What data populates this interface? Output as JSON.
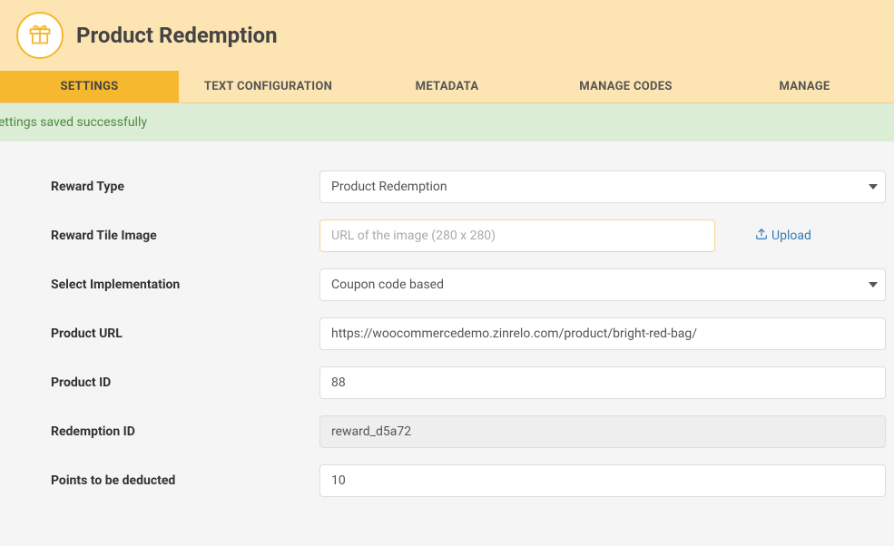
{
  "header": {
    "title": "Product Redemption",
    "icon": "gift-icon"
  },
  "tabs": [
    {
      "label": "SETTINGS",
      "active": true
    },
    {
      "label": "TEXT CONFIGURATION",
      "active": false
    },
    {
      "label": "METADATA",
      "active": false
    },
    {
      "label": "MANAGE CODES",
      "active": false
    },
    {
      "label": "MANAGE",
      "active": false
    }
  ],
  "banner": {
    "message": "ettings saved successfully"
  },
  "form": {
    "reward_type": {
      "label": "Reward Type",
      "value": "Product Redemption"
    },
    "reward_tile_image": {
      "label": "Reward Tile Image",
      "placeholder": "URL of the image (280 x 280)",
      "value": "",
      "upload_label": "Upload"
    },
    "select_implementation": {
      "label": "Select Implementation",
      "value": "Coupon code based"
    },
    "product_url": {
      "label": "Product URL",
      "value": "https://woocommercedemo.zinrelo.com/product/bright-red-bag/"
    },
    "product_id": {
      "label": "Product ID",
      "value": "88"
    },
    "redemption_id": {
      "label": "Redemption ID",
      "value": "reward_d5a72"
    },
    "points_to_be_deducted": {
      "label": "Points to be deducted",
      "value": "10"
    },
    "auto_redeem": {
      "label": ""
    }
  },
  "colors": {
    "accent": "#f5b82e",
    "header_bg": "#fce4b3",
    "success_bg": "#dcedd6",
    "success_text": "#4a8a3f",
    "link": "#337ab7"
  }
}
